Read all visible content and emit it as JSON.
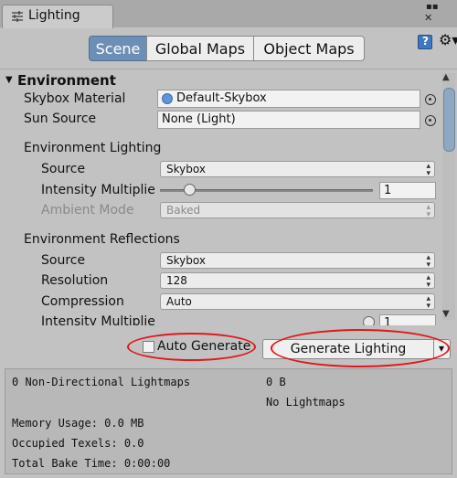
{
  "window": {
    "tab_title": "Lighting",
    "menu_glyph": "▪▪",
    "close_glyph": "✕"
  },
  "toolbar": {
    "tabs": [
      {
        "label": "Scene",
        "active": true
      },
      {
        "label": "Global Maps",
        "active": false
      },
      {
        "label": "Object Maps",
        "active": false
      }
    ],
    "gear_glyph": "⚙▾"
  },
  "environment": {
    "header": "Environment",
    "skybox_material": {
      "label": "Skybox Material",
      "value": "Default-Skybox"
    },
    "sun_source": {
      "label": "Sun Source",
      "value": "None (Light)"
    },
    "lighting": {
      "header": "Environment Lighting",
      "source": {
        "label": "Source",
        "value": "Skybox"
      },
      "intensity": {
        "label": "Intensity Multiplie",
        "value": "1",
        "fraction": 0.14
      },
      "ambient_mode": {
        "label": "Ambient Mode",
        "value": "Baked"
      }
    },
    "reflections": {
      "header": "Environment Reflections",
      "source": {
        "label": "Source",
        "value": "Skybox"
      },
      "resolution": {
        "label": "Resolution",
        "value": "128"
      },
      "compression": {
        "label": "Compression",
        "value": "Auto"
      },
      "intensity": {
        "label": "Intensity Multiplie",
        "value": "1"
      }
    }
  },
  "bottom": {
    "auto_generate_label": "Auto Generate",
    "auto_generate_checked": false,
    "generate_label": "Generate Lighting"
  },
  "stats": {
    "lightmaps_label": "0 Non-Directional Lightmaps",
    "lightmaps_size": "0 B",
    "no_lightmaps": "No Lightmaps",
    "memory_usage": "Memory Usage: 0.0 MB",
    "occupied_texels": "Occupied Texels: 0.0",
    "total_bake_time": "Total Bake Time: 0:00:00"
  },
  "colors": {
    "annotation": "#e0171a",
    "active_tab": "#6d8fb5"
  }
}
